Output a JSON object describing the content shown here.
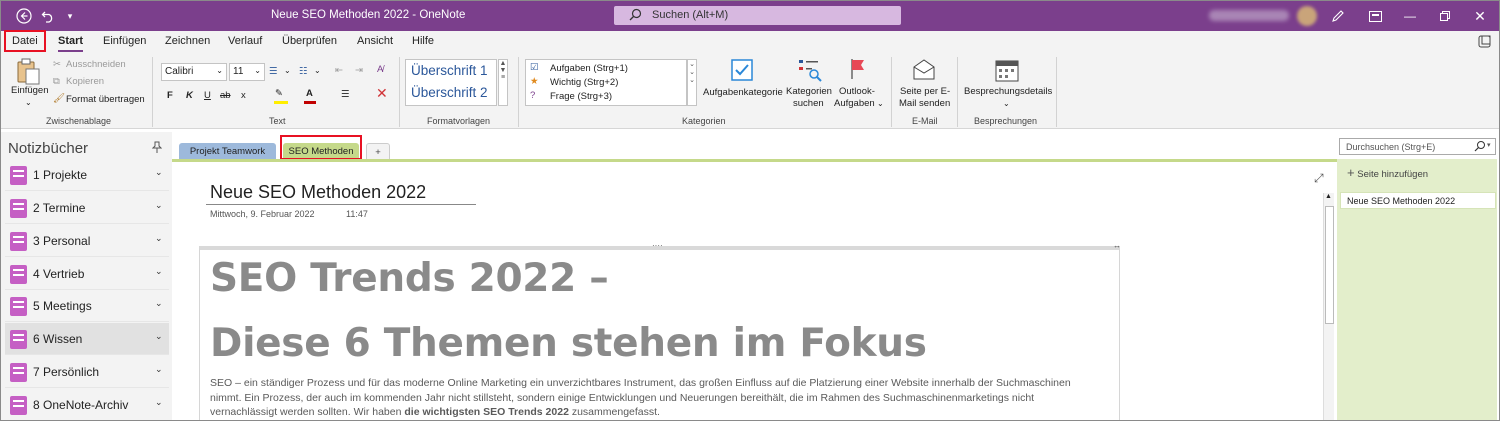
{
  "titlebar": {
    "title": "Neue SEO Methoden 2022  -  OneNote",
    "search_label": "Suchen (Alt+M)"
  },
  "ribbon_tabs": [
    "Datei",
    "Start",
    "Einfügen",
    "Zeichnen",
    "Verlauf",
    "Überprüfen",
    "Ansicht",
    "Hilfe"
  ],
  "active_tab": "Start",
  "clipboard": {
    "paste": "Einfügen",
    "cut": "Ausschneiden",
    "copy": "Kopieren",
    "format_painter": "Format übertragen",
    "group": "Zwischenablage"
  },
  "text": {
    "font": "Calibri",
    "size": "11",
    "bold": "F",
    "italic": "K",
    "underline": "U",
    "strike": "ab",
    "subscript": "x",
    "group": "Text"
  },
  "styles": {
    "h1": "Überschrift 1",
    "h2": "Überschrift 2",
    "group": "Formatvorlagen"
  },
  "tags": {
    "items": [
      "Aufgaben (Strg+1)",
      "Wichtig (Strg+2)",
      "Frage (Strg+3)"
    ],
    "tag_category": "Aufgabenkategorie",
    "find_tags_1": "Kategorien",
    "find_tags_2": "suchen",
    "outlook_1": "Outlook-",
    "outlook_2": "Aufgaben",
    "group": "Kategorien"
  },
  "email": {
    "line1": "Seite per E-",
    "line2": "Mail senden",
    "group": "E-Mail"
  },
  "meetings": {
    "details": "Besprechungsdetails",
    "group": "Besprechungen"
  },
  "notebooks": {
    "header": "Notizbücher",
    "items": [
      "1 Projekte",
      "2 Termine",
      "3 Personal",
      "4 Vertrieb",
      "5 Meetings",
      "6 Wissen",
      "7 Persönlich",
      "8 OneNote-Archiv"
    ],
    "selected": "6 Wissen"
  },
  "sections": {
    "tabs": [
      "Projekt Teamwork",
      "SEO Methoden",
      "+"
    ],
    "active": "SEO Methoden"
  },
  "page": {
    "title": "Neue SEO Methoden 2022",
    "date": "Mittwoch, 9. Februar 2022",
    "time": "11:47",
    "heading_line1": "SEO Trends 2022 –",
    "heading_line2": "Diese 6 Themen stehen im Fokus",
    "paragraph_plain": "SEO – ein ständiger Prozess und für das moderne Online Marketing ein unverzichtbares Instrument, das großen Einfluss auf die Platzierung einer Website innerhalb der Suchmaschinen nimmt. Ein Prozess, der auch im kommenden Jahr nicht stillsteht, sondern einige Entwicklungen und Neuerungen bereithält, die im Rahmen des Suchmaschinenmarketings nicht vernachlässigt werden sollten. Wir haben ",
    "paragraph_bold": "die wichtigsten SEO Trends 2022",
    "paragraph_end": " zusammengefasst."
  },
  "pages_panel": {
    "search_placeholder": "Durchsuchen (Strg+E)",
    "add_page": "Seite hinzufügen",
    "pages": [
      "Neue SEO Methoden 2022"
    ]
  },
  "colors": {
    "titlebar": "#7b3f8c",
    "notebook_icon": "#c55fc4",
    "section_teamwork": "#9db9db",
    "section_seo": "#c5d98a",
    "highlight_box": "#e81123"
  }
}
